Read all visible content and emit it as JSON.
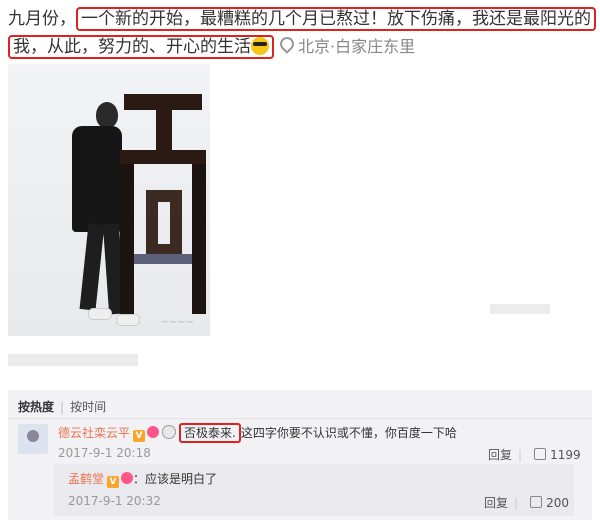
{
  "post": {
    "prefix": "九月份，",
    "highlight1": "一个新的开始，最糟糕的几个月已熬过！放下伤痛，我还是最阳光的",
    "highlight2": "我，从此，努力的、开心的生活",
    "location": "北京·白家庄东里"
  },
  "comments": {
    "tabs": {
      "hot": "按热度",
      "time": "按时间"
    },
    "main": {
      "username": "德云社栾云平",
      "highlight": "否极泰来.",
      "text": "这四字你要不认识或不懂，你百度一下哈",
      "time": "2017-9-1 20:18",
      "reply_label": "回复",
      "likes": "1199"
    },
    "reply": {
      "username": "孟鹤堂",
      "text": "：应该是明白了",
      "time": "2017-9-1 20:32",
      "reply_label": "回复",
      "likes": "200"
    }
  },
  "colors": {
    "highlight_border": "#dd2222",
    "username": "#eb7350"
  }
}
